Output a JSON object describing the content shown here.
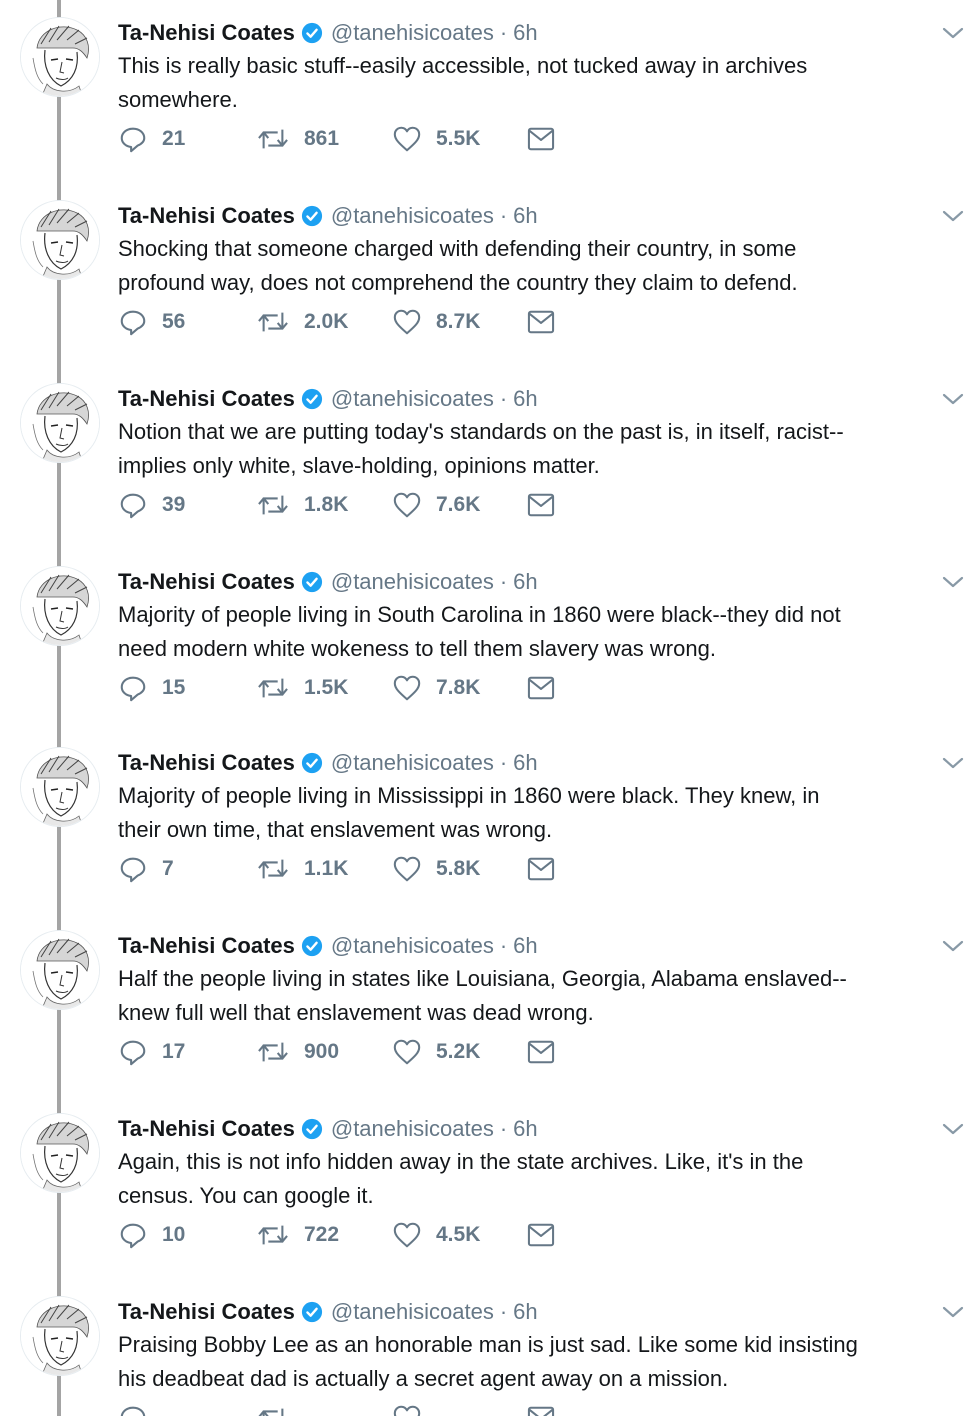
{
  "author": {
    "name": "Ta-Nehisi Coates",
    "handle": "@tanehisicoates",
    "separator": "·"
  },
  "icons": {
    "verified": "verified-badge-icon",
    "caret": "chevron-down-icon",
    "reply": "reply-icon",
    "retweet": "retweet-icon",
    "like": "heart-icon",
    "dm": "envelope-icon"
  },
  "colors": {
    "verified": "#1da1f2",
    "icon_gray": "#657786",
    "thread_line": "#a4a4a4"
  },
  "tweets": [
    {
      "time": "6h",
      "line1": "This is really basic stuff--easily accessible, not tucked away in archives",
      "line2": "somewhere.",
      "replies": "21",
      "retweets": "861",
      "likes": "5.5K"
    },
    {
      "time": "6h",
      "line1": "Shocking that someone charged with defending their country, in some",
      "line2": "profound way, does not comprehend the country they claim to defend.",
      "replies": "56",
      "retweets": "2.0K",
      "likes": "8.7K"
    },
    {
      "time": "6h",
      "line1": "Notion that we are putting today's standards on the past is, in itself, racist--",
      "line2": "implies only white, slave-holding, opinions matter.",
      "replies": "39",
      "retweets": "1.8K",
      "likes": "7.6K"
    },
    {
      "time": "6h",
      "line1": "Majority of people living in South Carolina in 1860 were black--they did not",
      "line2": "need modern white wokeness to tell them slavery was wrong.",
      "replies": "15",
      "retweets": "1.5K",
      "likes": "7.8K"
    },
    {
      "time": "6h",
      "line1": "Majority of people living in Mississippi in 1860 were black. They knew, in",
      "line2": "their own time, that enslavement was wrong.",
      "replies": "7",
      "retweets": "1.1K",
      "likes": "5.8K"
    },
    {
      "time": "6h",
      "line1": "Half the people living in states like Louisiana, Georgia, Alabama enslaved--",
      "line2": "knew full well that enslavement was dead wrong.",
      "replies": "17",
      "retweets": "900",
      "likes": "5.2K"
    },
    {
      "time": "6h",
      "line1": "Again, this is not info hidden away in the state archives. Like, it's in the",
      "line2": "census. You can google it.",
      "replies": "10",
      "retweets": "722",
      "likes": "4.5K"
    },
    {
      "time": "6h",
      "line1": "Praising Bobby Lee as an honorable man is just sad. Like some kid insisting",
      "line2": "his deadbeat dad is actually a secret agent away on a mission.",
      "replies": "",
      "retweets": "",
      "likes": ""
    }
  ]
}
